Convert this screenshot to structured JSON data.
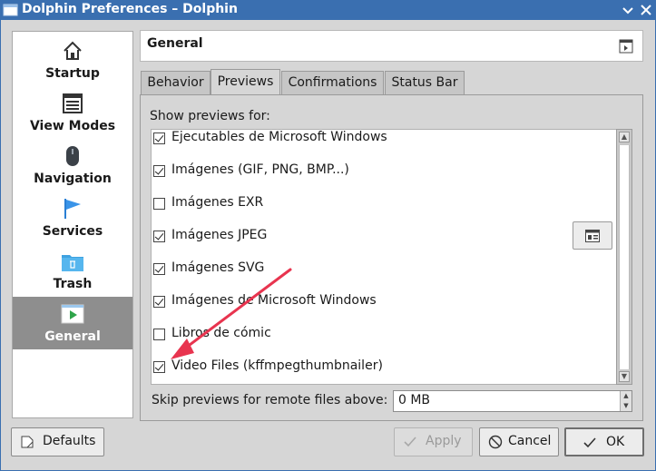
{
  "window": {
    "title": "Dolphin Preferences – Dolphin"
  },
  "sidebar": {
    "items": [
      {
        "label": "Startup",
        "icon": "home-icon"
      },
      {
        "label": "View Modes",
        "icon": "view-modes-icon"
      },
      {
        "label": "Navigation",
        "icon": "mouse-icon"
      },
      {
        "label": "Services",
        "icon": "flag-icon"
      },
      {
        "label": "Trash",
        "icon": "trash-folder-icon"
      },
      {
        "label": "General",
        "icon": "general-play-icon",
        "selected": true
      }
    ]
  },
  "header": {
    "title": "General"
  },
  "tabs": [
    {
      "label": "Behavior"
    },
    {
      "label": "Previews",
      "active": true
    },
    {
      "label": "Confirmations"
    },
    {
      "label": "Status Bar"
    }
  ],
  "previews": {
    "show_label": "Show previews for:",
    "items": [
      {
        "label": "Ejecutables de Microsoft Windows",
        "checked": true
      },
      {
        "label": "Imágenes (GIF, PNG, BMP...)",
        "checked": true
      },
      {
        "label": "Imágenes EXR",
        "checked": false
      },
      {
        "label": "Imágenes JPEG",
        "checked": true
      },
      {
        "label": "Imágenes SVG",
        "checked": true
      },
      {
        "label": "Imágenes de Microsoft Windows",
        "checked": true
      },
      {
        "label": "Libros de cómic",
        "checked": false
      },
      {
        "label": "Video Files (kffmpegthumbnailer)",
        "checked": true
      }
    ],
    "skip_label": "Skip previews for remote files above:",
    "skip_value": "0 MB"
  },
  "buttons": {
    "defaults": "Defaults",
    "apply": "Apply",
    "cancel": "Cancel",
    "ok": "OK"
  },
  "colors": {
    "titlebar": "#3a6fb0",
    "selection": "#8e8e8e",
    "annotation_arrow": "#e8344f"
  }
}
